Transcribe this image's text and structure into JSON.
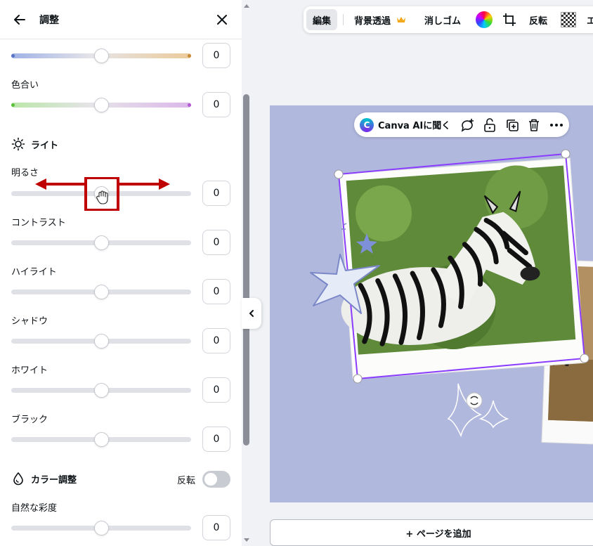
{
  "panel": {
    "title": "調整",
    "top_value": "0",
    "sections": {
      "light": "ライト",
      "color": "カラー調整"
    },
    "sliders": {
      "tint": {
        "label": "色合い",
        "value": "0"
      },
      "brightness": {
        "label": "明るさ",
        "value": "0"
      },
      "contrast": {
        "label": "コントラスト",
        "value": "0"
      },
      "highlights": {
        "label": "ハイライト",
        "value": "0"
      },
      "shadows": {
        "label": "シャドウ",
        "value": "0"
      },
      "whites": {
        "label": "ホワイト",
        "value": "0"
      },
      "blacks": {
        "label": "ブラック",
        "value": "0"
      },
      "vibrance": {
        "label": "自然な彩度",
        "value": "0"
      }
    },
    "invert_label": "反転"
  },
  "toolbar": {
    "edit": "編集",
    "bg_remove": "背景透過",
    "eraser": "消しゴム",
    "flip": "反転",
    "cut_off": "エ"
  },
  "context_bar": {
    "ask_ai": "Canva AIに聞く"
  },
  "add_page": "+ ページを追加",
  "colors": {
    "accent": "#8b3dff",
    "annotation": "#c00000",
    "canvas_bg": "#b1b8de"
  }
}
